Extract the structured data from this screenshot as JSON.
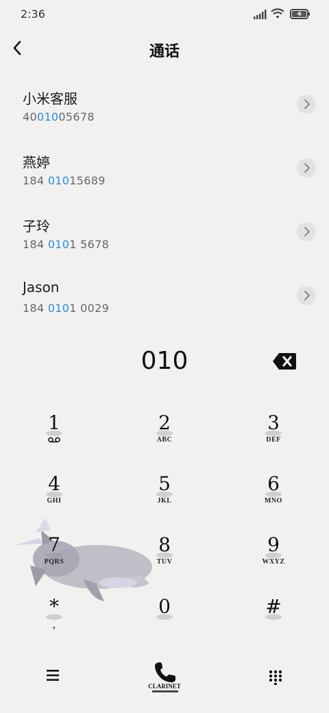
{
  "status": {
    "time": "2:36"
  },
  "header": {
    "title": "通话"
  },
  "contacts": [
    {
      "name": "小米客服",
      "num_pre": "40",
      "num_hl": "010",
      "num_post": "05678"
    },
    {
      "name": "燕婷",
      "num_pre": "184 ",
      "num_hl": "010",
      "num_post": "15689"
    },
    {
      "name": "子玲",
      "num_pre": "184 ",
      "num_hl": "010",
      "num_post": "1 5678"
    },
    {
      "name": "Jason",
      "num_pre": "184 ",
      "num_hl": "010",
      "num_post": "1 0029"
    }
  ],
  "dial": {
    "digits": "010"
  },
  "keypad": [
    {
      "digit": "1",
      "letters": ""
    },
    {
      "digit": "2",
      "letters": "ABC"
    },
    {
      "digit": "3",
      "letters": "DEF"
    },
    {
      "digit": "4",
      "letters": "GHI"
    },
    {
      "digit": "5",
      "letters": "JKL"
    },
    {
      "digit": "6",
      "letters": "MNO"
    },
    {
      "digit": "7",
      "letters": "PQRS"
    },
    {
      "digit": "8",
      "letters": "TUV"
    },
    {
      "digit": "9",
      "letters": "WXYZ"
    },
    {
      "digit": "*",
      "letters": ","
    },
    {
      "digit": "0",
      "letters": ""
    },
    {
      "digit": "#",
      "letters": ""
    }
  ],
  "bottom": {
    "call_caption": "CLARINET"
  },
  "colors": {
    "highlight": "#1f8fe0",
    "background": "#f3f1f0"
  }
}
